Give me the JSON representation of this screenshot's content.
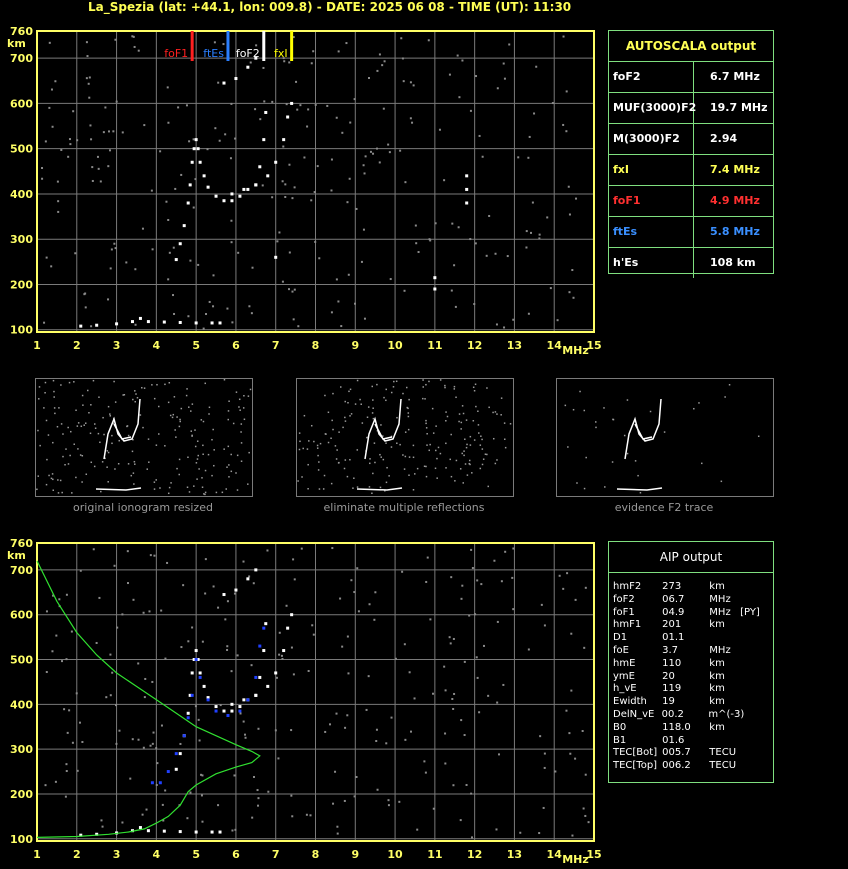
{
  "header": "La_Spezia (lat: +44.1, lon: 009.8) - DATE: 2025 06 08 - TIME (UT): 11:30",
  "colors": {
    "axis": "#ffff66",
    "grid": "#7a7a7a",
    "box": "#7fdf7f",
    "foF1": "#ff2020",
    "ftEs": "#2a7fff",
    "foF2": "#ffffff",
    "fxI": "#ffff00"
  },
  "top_markers": [
    {
      "label": "foF1",
      "freq": 4.9,
      "color": "#ff2020"
    },
    {
      "label": "ftEs",
      "freq": 5.8,
      "color": "#2a7fff"
    },
    {
      "label": "foF2",
      "freq": 6.7,
      "color": "#ffffff"
    },
    {
      "label": "fxI",
      "freq": 7.4,
      "color": "#ffff00"
    }
  ],
  "autoscala": {
    "title": "AUTOSCALA output",
    "rows": [
      {
        "name": "foF2",
        "value": "6.7 MHz",
        "color": "#ffffff"
      },
      {
        "name": "MUF(3000)F2",
        "value": "19.7 MHz",
        "color": "#ffffff"
      },
      {
        "name": "M(3000)F2",
        "value": "2.94",
        "color": "#ffffff"
      },
      {
        "name": "fxI",
        "value": "7.4 MHz",
        "color": "#ffff55"
      },
      {
        "name": "foF1",
        "value": "4.9 MHz",
        "color": "#ff3030"
      },
      {
        "name": "ftEs",
        "value": "5.8 MHz",
        "color": "#3a8fff"
      },
      {
        "name": "h'Es",
        "value": "108     km",
        "color": "#ffffff"
      }
    ]
  },
  "thumbnails": [
    {
      "caption": "original ionogram resized"
    },
    {
      "caption": "eliminate multiple reflections"
    },
    {
      "caption": "evidence F2 trace"
    }
  ],
  "aip": {
    "title": "AIP output",
    "rows": [
      [
        "hmF2",
        "273",
        "km",
        ""
      ],
      [
        "foF2",
        "06.7",
        "MHz",
        ""
      ],
      [
        "foF1",
        "04.9",
        "MHz",
        "[PY]"
      ],
      [
        "hmF1",
        "201",
        "km",
        ""
      ],
      [
        "D1",
        "01.1",
        "",
        ""
      ],
      [
        "foE",
        "3.7",
        "MHz",
        ""
      ],
      [
        "hmE",
        "110",
        "km",
        ""
      ],
      [
        "ymE",
        "20",
        "km",
        ""
      ],
      [
        "h_vE",
        "119",
        "km",
        ""
      ],
      [
        "Ewidth",
        "19",
        "km",
        ""
      ],
      [
        "DelN_vE",
        "00.2",
        "m^(-3)",
        ""
      ],
      [
        "B0",
        "118.0",
        "km",
        ""
      ],
      [
        "B1",
        "01.6",
        "",
        ""
      ],
      [
        "TEC[Bot]",
        "005.7",
        "TECU",
        ""
      ],
      [
        "TEC[Top]",
        "006.2",
        "TECU",
        ""
      ]
    ]
  },
  "chart_data": [
    {
      "type": "scatter",
      "title": "",
      "xlabel": "MHz",
      "ylabel": "km",
      "xlim": [
        1,
        15
      ],
      "ylim": [
        95,
        760
      ],
      "xticks": [
        1,
        2,
        3,
        4,
        5,
        6,
        7,
        8,
        9,
        10,
        11,
        12,
        13,
        14,
        15
      ],
      "xtick_labels": [
        "1",
        "2",
        "3",
        "4",
        "5",
        "6",
        "7",
        "8",
        "9",
        "10",
        "11",
        "12",
        "13",
        "14",
        "15"
      ],
      "yticks": [
        100,
        200,
        300,
        400,
        500,
        600,
        700,
        760
      ],
      "ytick_labels": [
        "100",
        "200",
        "300",
        "400",
        "500",
        "600",
        "700",
        "760"
      ],
      "grid": true,
      "series": [
        {
          "color": "#ffffff",
          "points": [
            [
              2.1,
              108
            ],
            [
              2.5,
              110
            ],
            [
              3.0,
              113
            ],
            [
              3.4,
              118
            ],
            [
              3.6,
              125
            ],
            [
              3.8,
              118
            ],
            [
              4.2,
              117
            ],
            [
              4.6,
              116
            ],
            [
              5.0,
              115
            ],
            [
              5.4,
              115
            ],
            [
              5.6,
              115
            ],
            [
              4.5,
              255
            ],
            [
              4.6,
              290
            ],
            [
              4.7,
              330
            ],
            [
              4.8,
              380
            ],
            [
              4.85,
              420
            ],
            [
              4.9,
              470
            ],
            [
              4.95,
              500
            ],
            [
              5.0,
              520
            ],
            [
              5.05,
              500
            ],
            [
              5.1,
              470
            ],
            [
              5.2,
              440
            ],
            [
              5.3,
              415
            ],
            [
              5.5,
              395
            ],
            [
              5.7,
              385
            ],
            [
              5.9,
              385
            ],
            [
              6.1,
              395
            ],
            [
              6.3,
              410
            ],
            [
              6.5,
              420
            ],
            [
              6.6,
              460
            ],
            [
              6.7,
              520
            ],
            [
              6.75,
              580
            ],
            [
              5.9,
              400
            ],
            [
              6.2,
              410
            ],
            [
              6.5,
              420
            ],
            [
              6.8,
              440
            ],
            [
              7.0,
              470
            ],
            [
              7.2,
              520
            ],
            [
              7.3,
              570
            ],
            [
              7.4,
              600
            ],
            [
              5.7,
              645
            ],
            [
              6.0,
              655
            ],
            [
              6.3,
              680
            ],
            [
              6.5,
              700
            ],
            [
              11.8,
              380
            ],
            [
              11.8,
              410
            ],
            [
              11.8,
              440
            ],
            [
              7.0,
              260
            ],
            [
              11.0,
              190
            ],
            [
              11.0,
              215
            ]
          ]
        }
      ]
    },
    {
      "type": "line",
      "title": "",
      "xlabel": "MHz",
      "ylabel": "km",
      "xlim": [
        1,
        15
      ],
      "ylim": [
        95,
        760
      ],
      "grid": true,
      "series": [
        {
          "color": "#ffffff",
          "points": [
            [
              2.1,
              108
            ],
            [
              2.5,
              110
            ],
            [
              3.0,
              113
            ],
            [
              3.4,
              118
            ],
            [
              3.6,
              125
            ],
            [
              3.8,
              118
            ],
            [
              4.2,
              117
            ],
            [
              4.6,
              116
            ],
            [
              5.0,
              115
            ],
            [
              5.4,
              115
            ],
            [
              5.6,
              115
            ],
            [
              4.5,
              255
            ],
            [
              4.6,
              290
            ],
            [
              4.7,
              330
            ],
            [
              4.8,
              380
            ],
            [
              4.85,
              420
            ],
            [
              4.9,
              470
            ],
            [
              4.95,
              500
            ],
            [
              5.0,
              520
            ],
            [
              5.05,
              500
            ],
            [
              5.1,
              470
            ],
            [
              5.2,
              440
            ],
            [
              5.3,
              415
            ],
            [
              5.5,
              395
            ],
            [
              5.7,
              385
            ],
            [
              5.9,
              385
            ],
            [
              6.1,
              395
            ],
            [
              6.3,
              410
            ],
            [
              6.5,
              420
            ],
            [
              6.6,
              460
            ],
            [
              6.7,
              520
            ],
            [
              6.75,
              580
            ],
            [
              5.9,
              400
            ],
            [
              6.2,
              410
            ],
            [
              6.5,
              420
            ],
            [
              6.8,
              440
            ],
            [
              7.0,
              470
            ],
            [
              7.2,
              520
            ],
            [
              7.3,
              570
            ],
            [
              7.4,
              600
            ],
            [
              5.7,
              645
            ],
            [
              6.0,
              655
            ],
            [
              6.3,
              680
            ],
            [
              6.5,
              700
            ]
          ]
        },
        {
          "color": "#2040ff",
          "points": [
            [
              3.9,
              225
            ],
            [
              4.1,
              225
            ],
            [
              4.3,
              250
            ],
            [
              4.5,
              290
            ],
            [
              4.7,
              330
            ],
            [
              4.8,
              370
            ],
            [
              4.9,
              420
            ],
            [
              5.0,
              500
            ],
            [
              5.1,
              460
            ],
            [
              5.3,
              410
            ],
            [
              5.5,
              385
            ],
            [
              5.8,
              375
            ],
            [
              6.1,
              385
            ],
            [
              6.3,
              410
            ],
            [
              6.5,
              460
            ],
            [
              6.6,
              530
            ],
            [
              6.7,
              570
            ]
          ]
        },
        {
          "color": "#30e030",
          "line": [
            [
              1.0,
              720
            ],
            [
              1.5,
              630
            ],
            [
              2.0,
              560
            ],
            [
              2.5,
              510
            ],
            [
              3.0,
              470
            ],
            [
              3.5,
              440
            ],
            [
              4.0,
              410
            ],
            [
              4.5,
              380
            ],
            [
              5.0,
              350
            ],
            [
              5.5,
              330
            ],
            [
              6.0,
              310
            ],
            [
              6.4,
              295
            ],
            [
              6.6,
              285
            ],
            [
              6.4,
              270
            ],
            [
              6.0,
              260
            ],
            [
              5.5,
              245
            ],
            [
              5.0,
              220
            ],
            [
              4.8,
              205
            ],
            [
              4.6,
              175
            ],
            [
              4.3,
              150
            ],
            [
              4.0,
              135
            ],
            [
              3.7,
              122
            ],
            [
              3.3,
              115
            ],
            [
              2.8,
              110
            ],
            [
              2.0,
              105
            ],
            [
              1.0,
              103
            ]
          ]
        }
      ]
    }
  ]
}
